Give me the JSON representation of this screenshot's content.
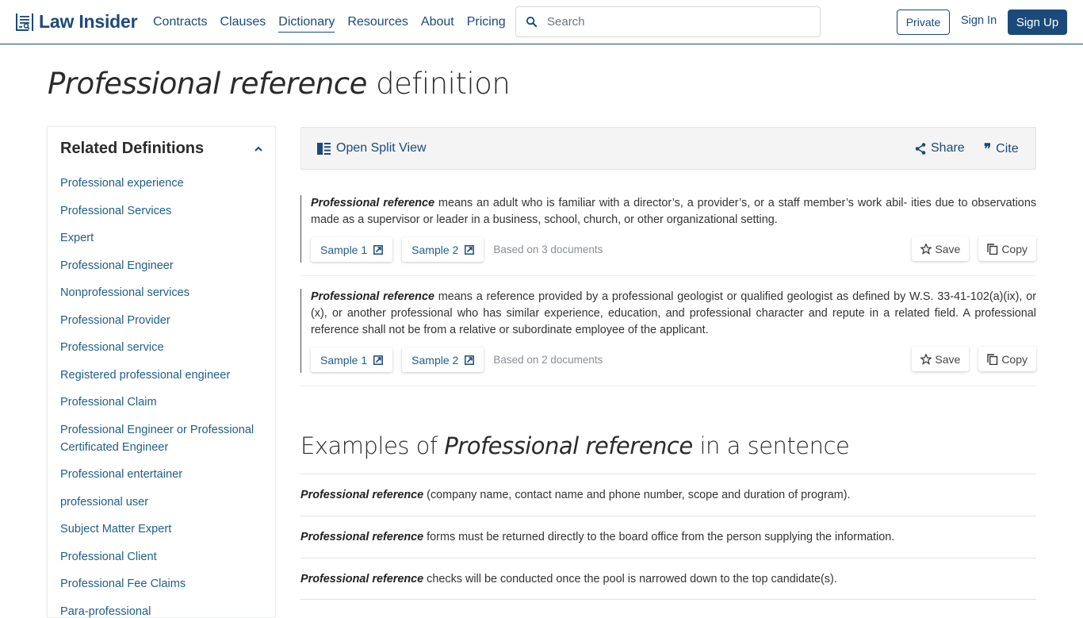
{
  "header": {
    "brand": "Law Insider",
    "nav": [
      {
        "label": "Contracts",
        "active": false
      },
      {
        "label": "Clauses",
        "active": false
      },
      {
        "label": "Dictionary",
        "active": true
      },
      {
        "label": "Resources",
        "active": false
      },
      {
        "label": "About",
        "active": false
      },
      {
        "label": "Pricing",
        "active": false
      }
    ],
    "search_placeholder": "Search",
    "private_label": "Private",
    "signin_label": "Sign In",
    "signup_label": "Sign Up"
  },
  "page": {
    "term": "Professional reference",
    "title_suffix": "definition"
  },
  "sidebar": {
    "title": "Related Definitions",
    "items": [
      "Professional experience",
      "Professional Services",
      "Expert",
      "Professional Engineer",
      "Nonprofessional services",
      "Professional Provider",
      "Professional service",
      "Registered professional engineer",
      "Professional Claim",
      "Professional Engineer or Professional Certificated Engineer",
      "Professional entertainer",
      "professional user",
      "Subject Matter Expert",
      "Professional Client",
      "Professional Fee Claims",
      "Para-professional"
    ]
  },
  "toolbar": {
    "split_view_label": "Open Split View",
    "share_label": "Share",
    "cite_label": "Cite"
  },
  "definitions": [
    {
      "term": "Professional reference",
      "text": "means an adult who is familiar with a director’s, a provider’s, or a staff member’s work abil- ities due to observations made as a supervisor or leader in a business, school, church, or other organizational setting.",
      "samples": [
        "Sample 1",
        "Sample 2"
      ],
      "based_on": "Based on 3 documents",
      "save_label": "Save",
      "copy_label": "Copy"
    },
    {
      "term": "Professional reference",
      "text": "means a reference provided by a professional geologist or qualified geologist as defined by W.S. 33-41-102(a)(ix), or (x), or another professional who has similar experience, education, and professional character and repute in a related field. A professional reference shall not be from a relative or subordinate employee of the applicant.",
      "samples": [
        "Sample 1",
        "Sample 2"
      ],
      "based_on": "Based on 2 documents",
      "save_label": "Save",
      "copy_label": "Copy"
    }
  ],
  "examples": {
    "title_prefix": "Examples of",
    "term": "Professional reference",
    "title_suffix": "in a sentence",
    "items": [
      {
        "term": "Professional reference",
        "text": "(company name, contact name and phone number, scope and duration of program)."
      },
      {
        "term": "Professional reference",
        "text": "forms must be returned directly to the board office from the person supplying the information."
      },
      {
        "term": "Professional reference",
        "text": "checks will be conducted once the pool is narrowed down to the top candidate(s)."
      }
    ]
  },
  "colors": {
    "brand": "#1b4a7a",
    "link": "#1e5f8a",
    "toolbar_bg": "#f4f4f4",
    "muted": "#8a8f94"
  }
}
